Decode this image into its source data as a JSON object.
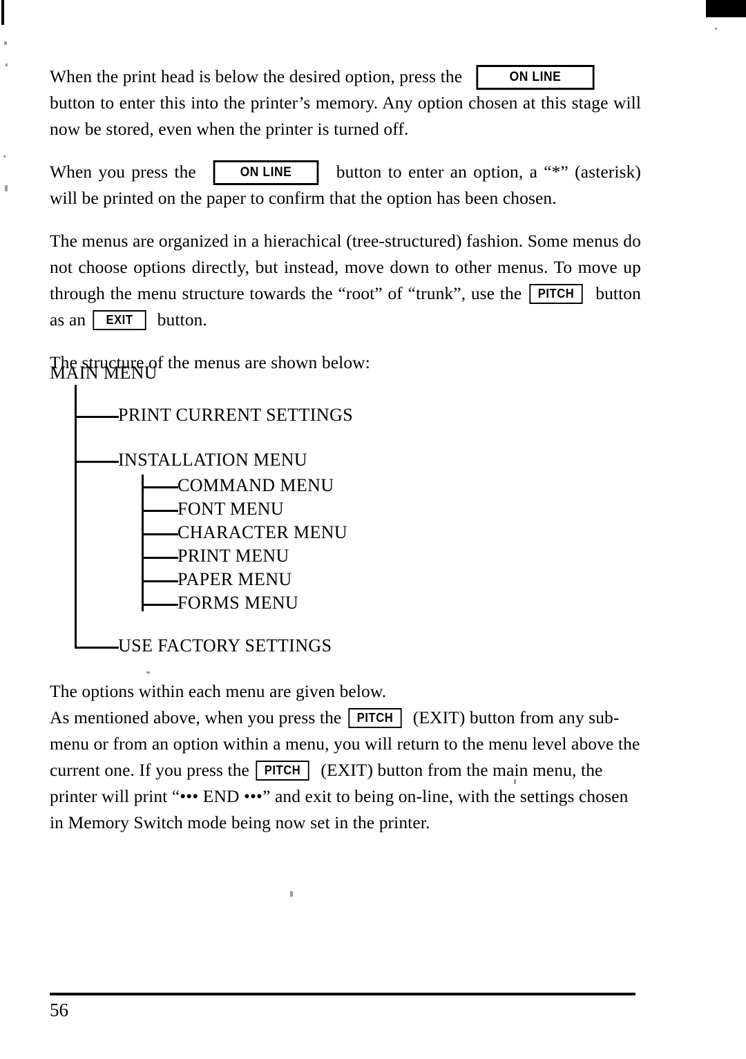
{
  "page": {
    "number": "56",
    "keys": {
      "online": "ON LINE",
      "pitch": "PITCH",
      "exit": "EXIT"
    }
  },
  "paragraphs": {
    "p1": {
      "part1": "When the print head is below the desired option, press the",
      "part2": "button to enter this into the printer’s memory. Any option chosen at this stage will now be stored, even when the printer is turned off."
    },
    "p2": {
      "part1": "When you press the",
      "part2": "button to enter an option, a “*” (asterisk) will be printed on the paper to confirm that the option has been chosen."
    },
    "p3": {
      "part1": "The menus are organized in a hierachical (tree-structured) fashion. Some menus do not choose options directly, but instead, move down to other menus. To move up through the menu structure towards the “root” of “trunk”, use the",
      "part2": "button as an",
      "part3": "button."
    },
    "p4": {
      "text": "The structure of the menus are shown below:"
    },
    "p5": {
      "line1": "The options within each menu are given below.",
      "part1": "As mentioned above, when you press the",
      "part2": "(EXIT) button from any sub-menu or from an option within a menu, you will return to the menu level above the current one. If you press the",
      "part3": "(EXIT) button from the main menu, the printer will print “••• END •••” and exit to being on-line, with the settings chosen in Memory Switch mode being now set in the printer."
    }
  },
  "tree": {
    "root": "MAIN MENU",
    "level1": [
      {
        "label": "PRINT CURRENT SETTINGS"
      },
      {
        "label": "INSTALLATION MENU"
      },
      {
        "label": "USE FACTORY SETTINGS"
      }
    ],
    "level2": [
      {
        "label": "COMMAND MENU"
      },
      {
        "label": "FONT MENU"
      },
      {
        "label": "CHARACTER MENU"
      },
      {
        "label": "PRINT MENU"
      },
      {
        "label": "PAPER MENU"
      },
      {
        "label": "FORMS MENU"
      }
    ]
  }
}
